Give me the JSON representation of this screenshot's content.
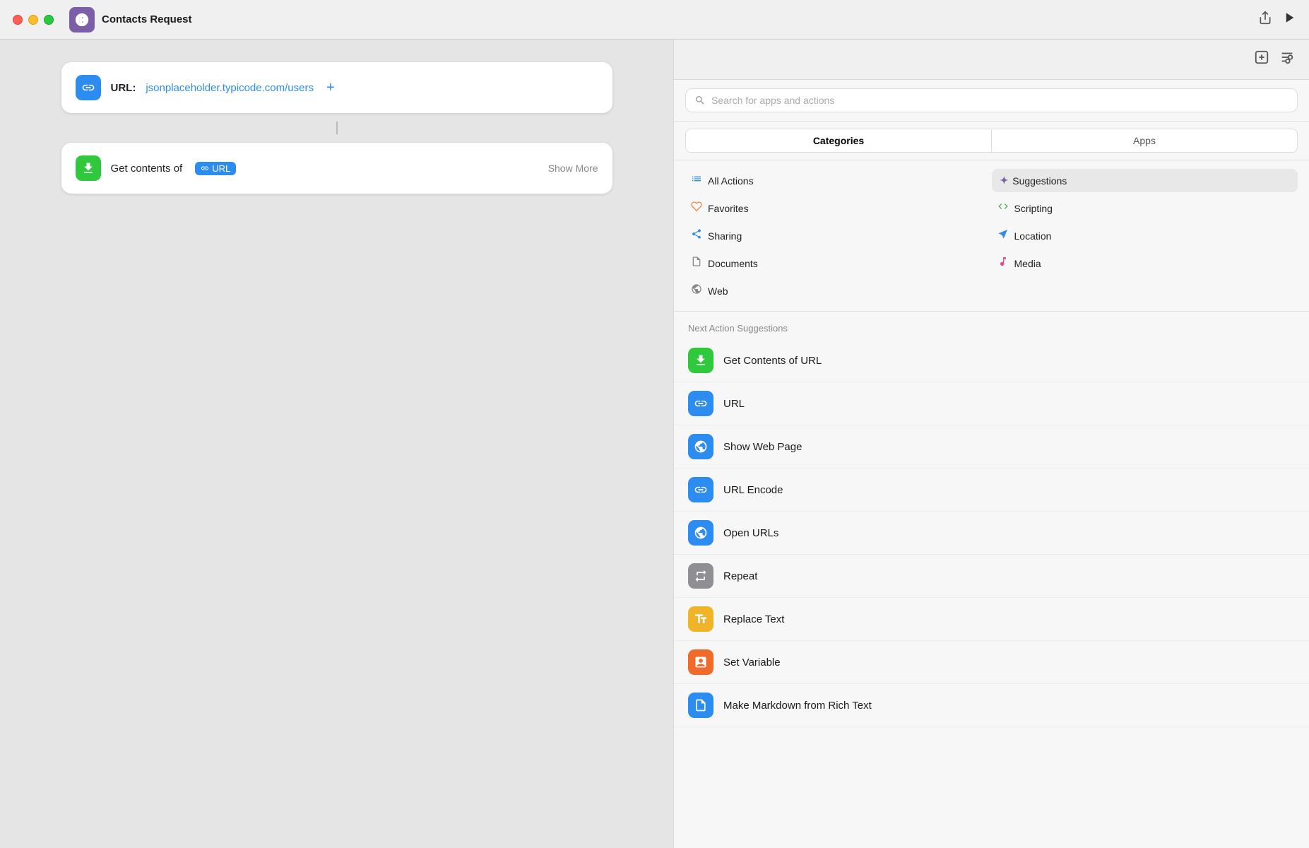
{
  "titleBar": {
    "title": "Contacts Request",
    "shareLabel": "Share",
    "playLabel": "Play"
  },
  "canvas": {
    "urlCard": {
      "label": "URL:",
      "value": "jsonplaceholder.typicode.com/users",
      "addLabel": "+"
    },
    "getContentsCard": {
      "text": "Get contents of",
      "token": "URL",
      "showMore": "Show More"
    }
  },
  "sidebar": {
    "searchPlaceholder": "Search for apps and actions",
    "tabs": [
      {
        "label": "Categories",
        "active": true
      },
      {
        "label": "Apps",
        "active": false
      }
    ],
    "filters": {
      "left": [
        {
          "label": "All Actions",
          "icon": "≡"
        },
        {
          "label": "Favorites",
          "icon": "♡"
        },
        {
          "label": "Sharing",
          "icon": "⬆"
        },
        {
          "label": "Documents",
          "icon": "📄"
        },
        {
          "label": "Web",
          "icon": "⊙"
        }
      ],
      "right": [
        {
          "label": "Suggestions",
          "icon": "✦",
          "active": true
        },
        {
          "label": "Scripting",
          "icon": "⟳"
        },
        {
          "label": "Location",
          "icon": "➤"
        },
        {
          "label": "Media",
          "icon": "♪"
        }
      ]
    },
    "suggestionsTitle": "Next Action Suggestions",
    "suggestions": [
      {
        "label": "Get Contents of URL",
        "iconColor": "si-green",
        "iconType": "download"
      },
      {
        "label": "URL",
        "iconColor": "si-blue",
        "iconType": "link"
      },
      {
        "label": "Show Web Page",
        "iconColor": "si-safari",
        "iconType": "globe"
      },
      {
        "label": "URL Encode",
        "iconColor": "si-blue",
        "iconType": "link"
      },
      {
        "label": "Open URLs",
        "iconColor": "si-safari",
        "iconType": "globe"
      },
      {
        "label": "Repeat",
        "iconColor": "si-gray",
        "iconType": "repeat"
      },
      {
        "label": "Replace Text",
        "iconColor": "si-yellow",
        "iconType": "text"
      },
      {
        "label": "Set Variable",
        "iconColor": "si-orange",
        "iconType": "variable"
      },
      {
        "label": "Make Markdown from Rich Text",
        "iconColor": "si-docblue",
        "iconType": "doc"
      }
    ]
  }
}
